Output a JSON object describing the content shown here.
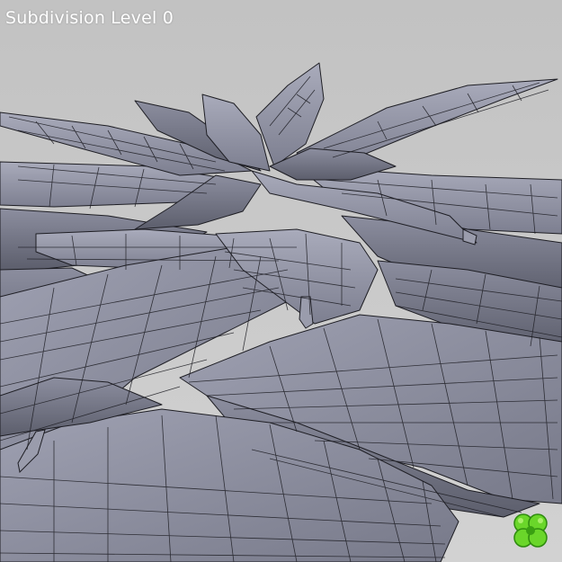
{
  "viewport": {
    "overlay_text": "Subdivision Level 0",
    "background_color": "#cdcdcd",
    "mesh_fill_color": "#8a8c9c",
    "mesh_light_color": "#a6a8b8",
    "mesh_dark_color": "#5f6170",
    "wire_color": "#1e1e24"
  },
  "logo": {
    "icon": "green-clover-logo-icon",
    "colors": [
      "#6ad62a",
      "#3aa012",
      "#b9f57a"
    ]
  }
}
